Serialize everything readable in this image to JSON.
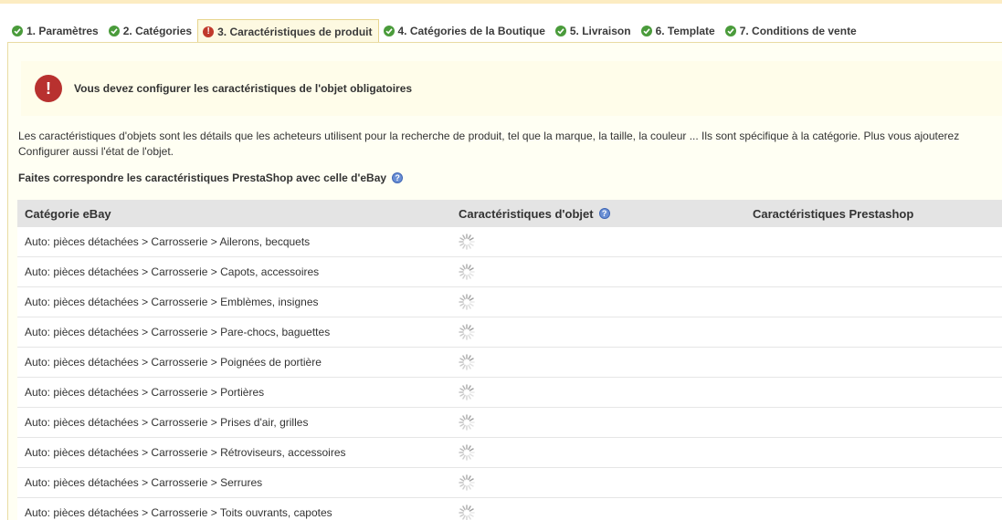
{
  "colors": {
    "panel_bg": "#fffff3",
    "ok": "#4a9b3b",
    "error": "#b8312f",
    "header_bg": "#e4e4e4"
  },
  "tabs": [
    {
      "label": "1. Paramètres",
      "status": "ok"
    },
    {
      "label": "2. Catégories",
      "status": "ok"
    },
    {
      "label": "3. Caractéristiques de produit",
      "status": "error"
    },
    {
      "label": "4. Catégories de la Boutique",
      "status": "ok"
    },
    {
      "label": "5. Livraison",
      "status": "ok"
    },
    {
      "label": "6. Template",
      "status": "ok"
    },
    {
      "label": "7. Conditions de vente",
      "status": "ok"
    }
  ],
  "alert": {
    "icon": "exclamation-icon",
    "text": "Vous devez configurer les caractéristiques de l'objet obligatoires"
  },
  "description": {
    "line1": "Les caractéristiques d'objets sont les détails que les acheteurs utilisent pour la recherche de produit, tel que la marque, la taille, la couleur ... Ils sont spécifique à la catégorie. Plus vous ajouterez",
    "line2": "Configurer aussi l'état de l'objet."
  },
  "subtitle": "Faites correspondre les caractéristiques PrestaShop avec celle d'eBay",
  "table": {
    "headers": {
      "ebay_category": "Catégorie eBay",
      "item_specifics": "Caractéristiques d'objet",
      "prestashop_features": "Caractéristiques Prestashop"
    },
    "rows": [
      "Auto: pièces détachées > Carrosserie > Ailerons, becquets",
      "Auto: pièces détachées > Carrosserie > Capots, accessoires",
      "Auto: pièces détachées > Carrosserie > Emblèmes, insignes",
      "Auto: pièces détachées > Carrosserie > Pare-chocs, baguettes",
      "Auto: pièces détachées > Carrosserie > Poignées de portière",
      "Auto: pièces détachées > Carrosserie > Portières",
      "Auto: pièces détachées > Carrosserie > Prises d'air, grilles",
      "Auto: pièces détachées > Carrosserie > Rétroviseurs, accessoires",
      "Auto: pièces détachées > Carrosserie > Serrures",
      "Auto: pièces détachées > Carrosserie > Toits ouvrants, capotes"
    ]
  }
}
